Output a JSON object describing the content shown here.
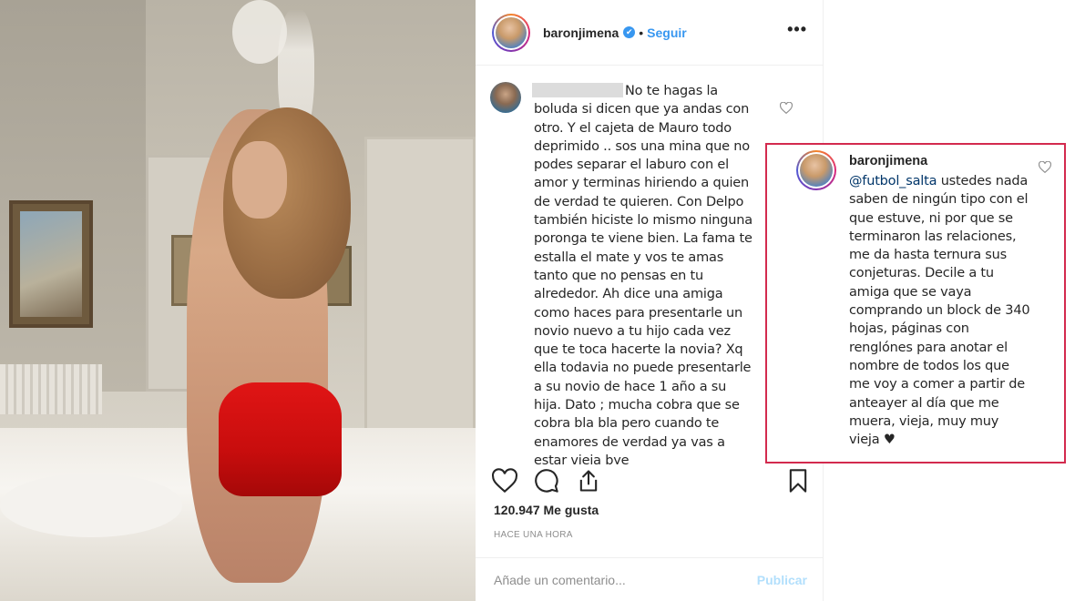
{
  "post": {
    "username": "baronjimena",
    "verified_mark": "✔",
    "separator": "•",
    "follow_label": "Seguir",
    "more_label": "•••"
  },
  "comment": {
    "text": "No te hagas la boluda si dicen que ya andas con otro. Y el cajeta de Mauro todo deprimido .. sos una mina que no podes separar el laburo con el amor y terminas hiriendo a quien de verdad te quieren. Con Delpo también hiciste lo mismo ninguna poronga te viene bien. La fama te estalla el mate y vos te amas tanto que no pensas en tu alrededor. Ah dice una amiga como haces para presentarle un novio nuevo a tu hijo cada vez que te toca hacerte la novia? Xq ella todavia no puede presentarle a su novio de hace 1 año a su hija. Dato ; mucha cobra que se cobra bla bla pero cuando te enamores de verdad ya vas a estar vieja bye",
    "heart_icon": "heart-outline-icon"
  },
  "actions": {
    "like_icon": "heart-icon",
    "comment_icon": "comment-icon",
    "share_icon": "share-icon",
    "save_icon": "bookmark-icon"
  },
  "likes": "120.947 Me gusta",
  "time": "HACE UNA HORA",
  "add_comment": {
    "placeholder": "Añade un comentario...",
    "publish_label": "Publicar"
  },
  "reply": {
    "username": "baronjimena",
    "mention": "@futbol_salta",
    "text": " ustedes nada saben de ningún tipo con el que estuve, ni por que se terminaron las relaciones, me da hasta ternura sus conjeturas. Decile a tu amiga que se vaya comprando un block de 340 hojas, páginas con renglónes para anotar el nombre de todos los que me voy a comer a partir de anteayer al día que me muera, vieja, muy muy vieja ♥",
    "border_color": "#d32a4e"
  },
  "colors": {
    "link_blue": "#3897f0",
    "muted": "#8e8e8e",
    "text": "#262626"
  }
}
